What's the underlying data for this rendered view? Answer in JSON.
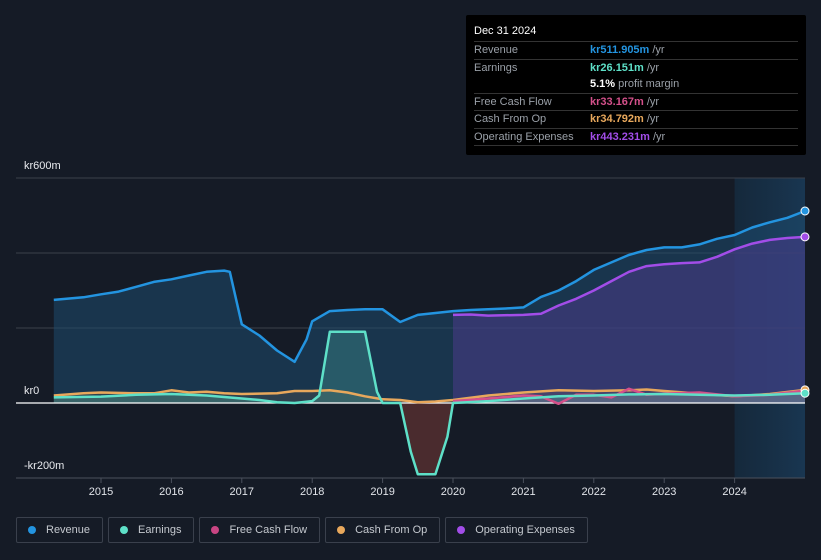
{
  "tooltip": {
    "date": "Dec 31 2024",
    "rows": [
      {
        "label": "Revenue",
        "value": "kr511.905m",
        "unit": "/yr",
        "color": "#2394e0"
      },
      {
        "label": "Earnings",
        "value": "kr26.151m",
        "unit": "/yr",
        "color": "#5ee0c8"
      },
      {
        "label": "",
        "value": "5.1%",
        "unit": "profit margin",
        "color": "#ffffff"
      },
      {
        "label": "Free Cash Flow",
        "value": "kr33.167m",
        "unit": "/yr",
        "color": "#d4508a"
      },
      {
        "label": "Cash From Op",
        "value": "kr34.792m",
        "unit": "/yr",
        "color": "#e8a85c"
      },
      {
        "label": "Operating Expenses",
        "value": "kr443.231m",
        "unit": "/yr",
        "color": "#a24de8"
      }
    ]
  },
  "legend": [
    {
      "label": "Revenue",
      "color": "#2394e0"
    },
    {
      "label": "Earnings",
      "color": "#5ee0c8"
    },
    {
      "label": "Free Cash Flow",
      "color": "#c94583"
    },
    {
      "label": "Cash From Op",
      "color": "#e8a85c"
    },
    {
      "label": "Operating Expenses",
      "color": "#a24de8"
    }
  ],
  "chart_data": {
    "type": "area",
    "title": "",
    "xlabel": "",
    "ylabel": "",
    "ylim": [
      -200,
      600
    ],
    "xlim": [
      2014.25,
      2025.0
    ],
    "y_ticks": [
      {
        "value": 600,
        "label": "kr600m"
      },
      {
        "value": 0,
        "label": "kr0"
      },
      {
        "value": -200,
        "label": "-kr200m"
      }
    ],
    "x_ticks": [
      "2015",
      "2016",
      "2017",
      "2018",
      "2019",
      "2020",
      "2021",
      "2022",
      "2023",
      "2024"
    ],
    "highlight_from": 2024.0,
    "grid": true,
    "legend_position": "bottom",
    "series": [
      {
        "name": "Revenue",
        "color": "#2394e0",
        "x": [
          2014.33,
          2014.75,
          2015.0,
          2015.25,
          2015.5,
          2015.75,
          2016.0,
          2016.25,
          2016.5,
          2016.75,
          2016.83,
          2017.0,
          2017.25,
          2017.5,
          2017.75,
          2017.92,
          2018.0,
          2018.25,
          2018.5,
          2018.75,
          2019.0,
          2019.25,
          2019.5,
          2019.75,
          2020.0,
          2020.25,
          2020.5,
          2020.75,
          2021.0,
          2021.25,
          2021.5,
          2021.75,
          2022.0,
          2022.25,
          2022.5,
          2022.75,
          2023.0,
          2023.25,
          2023.5,
          2023.75,
          2024.0,
          2024.25,
          2024.5,
          2024.75,
          2025.0
        ],
        "values": [
          275,
          282,
          290,
          297,
          310,
          323,
          330,
          340,
          350,
          353,
          350,
          210,
          180,
          140,
          110,
          170,
          218,
          245,
          248,
          250,
          250,
          216,
          235,
          240,
          245,
          248,
          250,
          252,
          255,
          283,
          300,
          325,
          355,
          375,
          395,
          408,
          415,
          415,
          423,
          438,
          448,
          468,
          482,
          494,
          512
        ]
      },
      {
        "name": "Earnings",
        "color": "#5ee0c8",
        "x": [
          2014.33,
          2015.0,
          2015.5,
          2016.0,
          2016.5,
          2017.0,
          2017.25,
          2017.5,
          2017.75,
          2018.0,
          2018.1,
          2018.25,
          2018.5,
          2018.75,
          2018.92,
          2019.0,
          2019.25,
          2019.4,
          2019.5,
          2019.75,
          2019.92,
          2020.0,
          2020.5,
          2021.0,
          2021.5,
          2022.0,
          2022.5,
          2023.0,
          2023.5,
          2024.0,
          2024.5,
          2025.0
        ],
        "values": [
          15,
          17,
          22,
          24,
          20,
          12,
          8,
          2,
          0,
          5,
          20,
          190,
          190,
          190,
          30,
          0,
          0,
          -130,
          -190,
          -190,
          -90,
          0,
          5,
          12,
          18,
          20,
          23,
          24,
          22,
          20,
          22,
          26
        ]
      },
      {
        "name": "Free Cash Flow",
        "color": "#d4508a",
        "x": [
          2020.0,
          2020.5,
          2021.0,
          2021.25,
          2021.5,
          2021.75,
          2022.0,
          2022.25,
          2022.5,
          2022.75,
          2023.0,
          2023.5,
          2024.0,
          2024.5,
          2025.0
        ],
        "values": [
          5,
          12,
          20,
          18,
          -2,
          22,
          22,
          15,
          38,
          22,
          25,
          28,
          18,
          22,
          33
        ]
      },
      {
        "name": "Cash From Op",
        "color": "#e8a85c",
        "x": [
          2014.33,
          2014.75,
          2015.0,
          2015.5,
          2015.75,
          2016.0,
          2016.25,
          2016.5,
          2016.75,
          2017.0,
          2017.5,
          2017.75,
          2018.0,
          2018.25,
          2018.5,
          2018.75,
          2019.0,
          2019.25,
          2019.5,
          2019.75,
          2020.0,
          2020.5,
          2021.0,
          2021.5,
          2022.0,
          2022.5,
          2022.75,
          2023.0,
          2023.5,
          2024.0,
          2024.5,
          2025.0
        ],
        "values": [
          20,
          26,
          28,
          26,
          26,
          34,
          28,
          30,
          26,
          24,
          26,
          32,
          32,
          34,
          28,
          18,
          10,
          8,
          2,
          4,
          8,
          20,
          28,
          34,
          32,
          34,
          36,
          32,
          25,
          18,
          24,
          35
        ]
      },
      {
        "name": "Operating Expenses",
        "color": "#a24de8",
        "x": [
          2020.0,
          2020.25,
          2020.5,
          2021.0,
          2021.25,
          2021.5,
          2021.75,
          2022.0,
          2022.25,
          2022.5,
          2022.75,
          2023.0,
          2023.25,
          2023.5,
          2023.75,
          2024.0,
          2024.25,
          2024.5,
          2024.75,
          2025.0
        ],
        "values": [
          235,
          236,
          233,
          235,
          238,
          260,
          278,
          300,
          325,
          350,
          365,
          370,
          373,
          375,
          390,
          410,
          425,
          435,
          440,
          443
        ]
      }
    ]
  }
}
